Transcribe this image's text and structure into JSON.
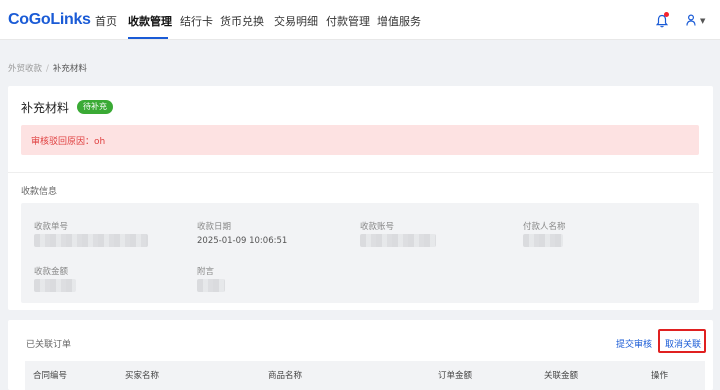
{
  "brand": "CoGoLinks",
  "nav": {
    "items": [
      "首页",
      "收款管理",
      "结行卡",
      "货币兑换",
      "交易明细",
      "付款管理",
      "增值服务"
    ],
    "active": "收款管理"
  },
  "breadcrumb": {
    "parent": "外贸收款",
    "separator": "/",
    "current": "补充材料"
  },
  "page": {
    "title": "补充材料",
    "status_badge": "待补充",
    "alert_text": "审核驳回原因：oh"
  },
  "payment_info": {
    "section_title": "收款信息",
    "fields": [
      {
        "label": "收款单号",
        "value": ""
      },
      {
        "label": "收款日期",
        "value": "2025-01-09 10:06:51"
      },
      {
        "label": "收款账号",
        "value": ""
      },
      {
        "label": "付款人名称",
        "value": ""
      },
      {
        "label": "收款金额",
        "value": ""
      },
      {
        "label": "附言",
        "value": ""
      }
    ]
  },
  "linked_orders": {
    "title": "已关联订单",
    "submit_label": "提交审核",
    "cancel_label": "取消关联",
    "columns": [
      "合同编号",
      "买家名称",
      "商品名称",
      "订单金额",
      "关联金额",
      "操作"
    ]
  },
  "colors": {
    "accent": "#1a5bd6",
    "success": "#3aaa35",
    "error": "#e04040",
    "highlight_box": "#e02020"
  }
}
